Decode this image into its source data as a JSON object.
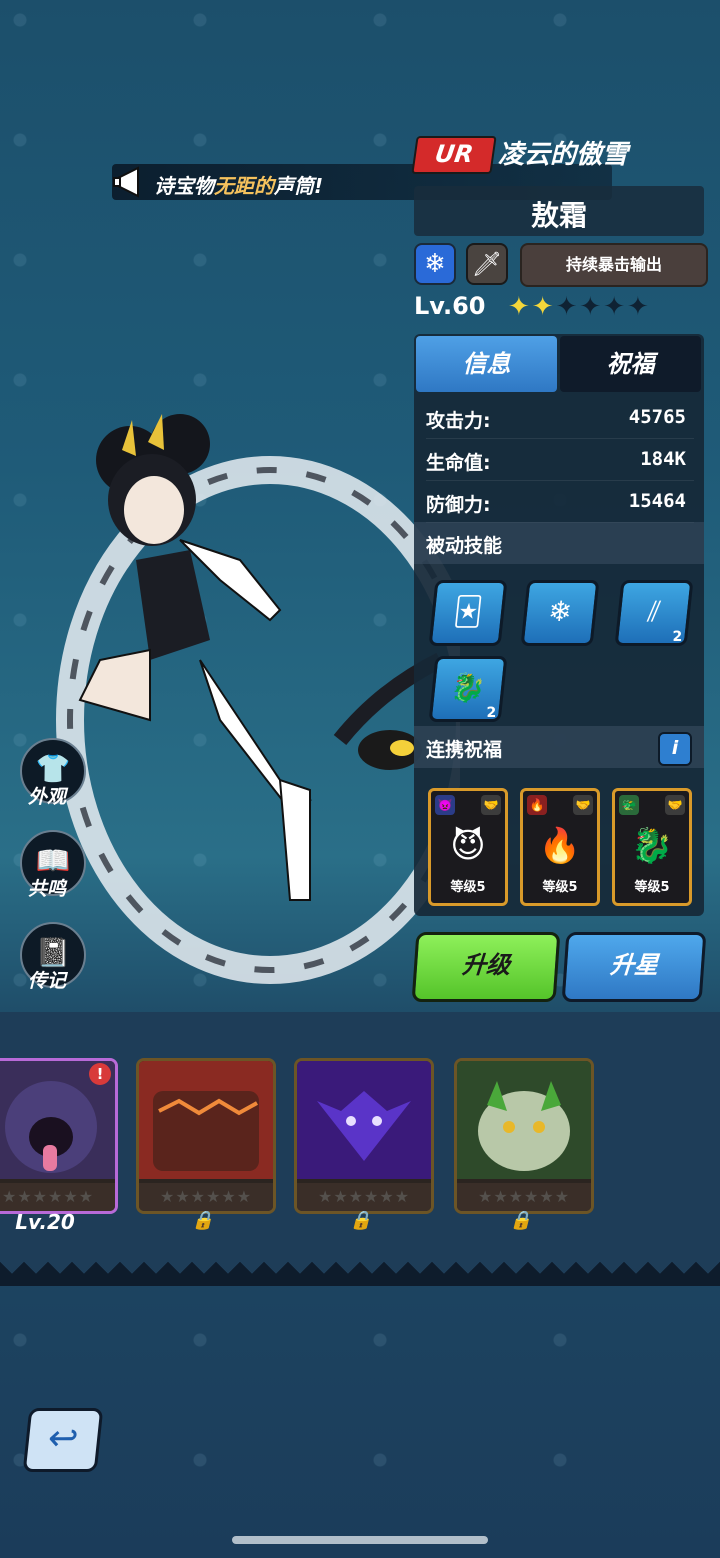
{
  "ticker": {
    "text_prefix": "诗宝物",
    "text_highlight": "无距的",
    "text_suffix": "声筒!"
  },
  "hero": {
    "rarity": "UR",
    "title": "凌云的傲雪",
    "name": "敖霜",
    "element_icon": "snowflake-icon",
    "weapon_icon": "sword-icon",
    "role": "持续暴击输出",
    "level": "Lv.60",
    "stars_filled": 2,
    "stars_total": 6
  },
  "tabs": {
    "info": "信息",
    "blessing": "祝福"
  },
  "stats": [
    {
      "label": "攻击力:",
      "value": "45765"
    },
    {
      "label": "生命值:",
      "value": "184K"
    },
    {
      "label": "防御力:",
      "value": "15464"
    }
  ],
  "passive": {
    "label": "被动技能",
    "skills": [
      {
        "icon": "cards-icon",
        "count": ""
      },
      {
        "icon": "snowflakes-icon",
        "count": ""
      },
      {
        "icon": "claw-slash-icon",
        "count": "2"
      },
      {
        "icon": "dragon-emblem-icon",
        "count": "2"
      }
    ]
  },
  "combo": {
    "label": "连携祝福",
    "info_glyph": "i",
    "items": [
      {
        "icon": "purple-imp-icon",
        "label": "等级5"
      },
      {
        "icon": "red-flame-icon",
        "label": "等级5"
      },
      {
        "icon": "green-dragon-icon",
        "label": "等级5"
      }
    ]
  },
  "buttons": {
    "upgrade": "升级",
    "star_up": "升星"
  },
  "side_menu": [
    {
      "label": "外观",
      "icon": "shirt-icon"
    },
    {
      "label": "共鸣",
      "icon": "book-icon"
    },
    {
      "label": "传记",
      "icon": "journal-icon"
    }
  ],
  "pets": [
    {
      "name": "purple-beast",
      "level": "Lv.20",
      "locked": false,
      "alert": "!"
    },
    {
      "name": "lava-chest",
      "level": "",
      "locked": true
    },
    {
      "name": "void-dragon",
      "level": "",
      "locked": true
    },
    {
      "name": "forest-spirit",
      "level": "",
      "locked": true
    }
  ],
  "colors": {
    "accent_blue": "#2f78c4",
    "accent_green": "#55c42a",
    "ur_red": "#d42a2a",
    "gold": "#d99a2a"
  }
}
